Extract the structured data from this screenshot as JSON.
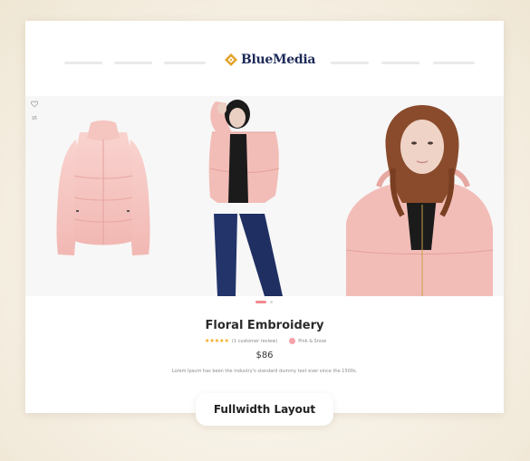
{
  "brand": {
    "logo_text": "BlueMedia",
    "logo_icon": "diamond-logo-icon",
    "accent": "#e1a227",
    "navy": "#1d2a58"
  },
  "nav": {
    "placeholder_items": 6
  },
  "gallery": {
    "icons": [
      "heart-icon",
      "compare-icon"
    ],
    "images": [
      "pink-puffer-jacket-flat",
      "model-in-pink-jacket-full",
      "model-in-pink-jacket-closeup"
    ],
    "active_dot_color": "#f08a8f",
    "inactive_dot_color": "#d9d9d9"
  },
  "product": {
    "title": "Floral Embroidery",
    "rating_stars": "★★★★★",
    "review_text": "(1 customer review)",
    "color_label": "Pink & Snow",
    "swatch_color": "#f6a3a9",
    "price": "$86",
    "description": "Lorem Ipsum has been the industry's standard dummy text ever since the 1500s."
  },
  "badge": {
    "label": "Fullwidth Layout"
  }
}
